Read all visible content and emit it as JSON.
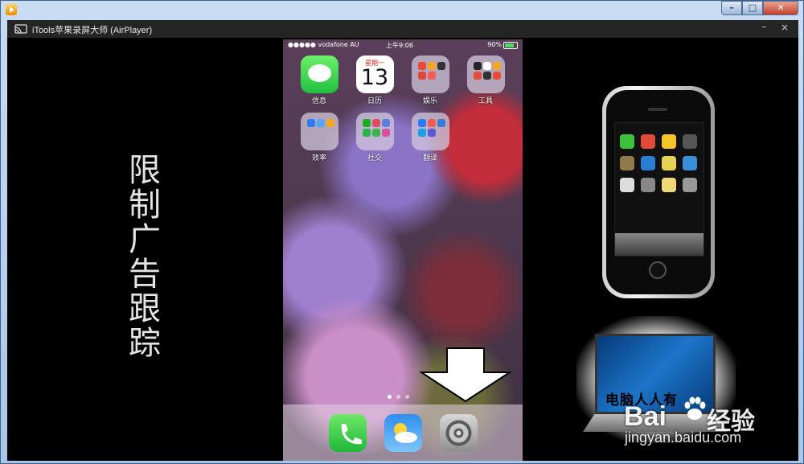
{
  "window": {
    "title": "iTools苹果录屏大师 (AirPlayer)",
    "min_glyph": "–",
    "close_glyph": "×"
  },
  "caption": {
    "chars": [
      "限",
      "制",
      "广",
      "告",
      "跟",
      "踪"
    ]
  },
  "phone": {
    "carrier": "vodafone AU",
    "time": "上午9:06",
    "battery": "90%",
    "apps": [
      {
        "label": "信息",
        "icon": "messages-icon"
      },
      {
        "label": "日历",
        "icon": "calendar-icon",
        "weekday": "星期一",
        "day": "13"
      },
      {
        "label": "娱乐",
        "icon": "folder-icon"
      },
      {
        "label": "工具",
        "icon": "folder-icon"
      },
      {
        "label": "效率",
        "icon": "folder-icon"
      },
      {
        "label": "社交",
        "icon": "folder-icon"
      },
      {
        "label": "翻译",
        "icon": "folder-icon"
      }
    ],
    "dock": [
      {
        "icon": "phone-icon"
      },
      {
        "icon": "weather-icon"
      },
      {
        "icon": "settings-icon"
      }
    ]
  },
  "laptop": {
    "text": "电脑人人有"
  },
  "watermark": {
    "logo": "Bai",
    "logo_cn": "经验",
    "url": "jingyan.baidu.com"
  },
  "colors": {
    "accent": "#1fb83a",
    "frame": "#a9c6e8"
  }
}
